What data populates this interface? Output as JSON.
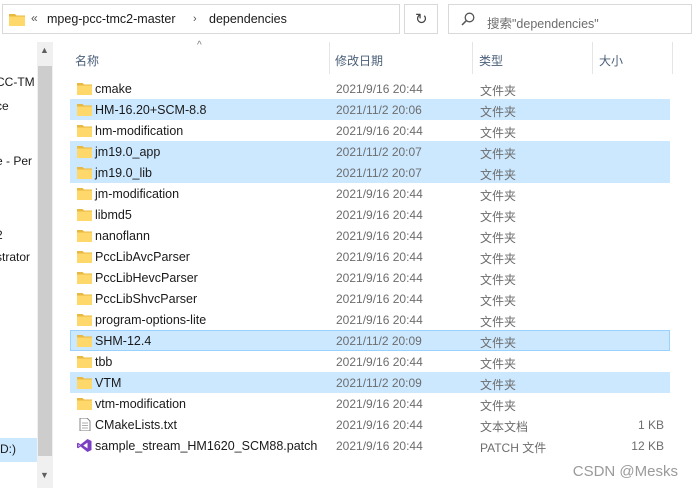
{
  "address": {
    "crumbs": [
      "mpeg-pcc-tmc2-master",
      "dependencies"
    ],
    "overflow": "«"
  },
  "search": {
    "placeholder": "搜索\"dependencies\""
  },
  "nav": {
    "items": [
      "CC-TM",
      "ce",
      "e - Per",
      "2",
      "strator",
      "D:)"
    ]
  },
  "columns": {
    "name": "名称",
    "date": "修改日期",
    "type": "类型",
    "size": "大小"
  },
  "rows": [
    {
      "name": "cmake",
      "date": "2021/9/16 20:44",
      "type": "文件夹",
      "size": "",
      "icon": "folder-icon",
      "state": ""
    },
    {
      "name": "HM-16.20+SCM-8.8",
      "date": "2021/11/2 20:06",
      "type": "文件夹",
      "size": "",
      "icon": "folder-icon",
      "state": "sel"
    },
    {
      "name": "hm-modification",
      "date": "2021/9/16 20:44",
      "type": "文件夹",
      "size": "",
      "icon": "folder-icon",
      "state": ""
    },
    {
      "name": "jm19.0_app",
      "date": "2021/11/2 20:07",
      "type": "文件夹",
      "size": "",
      "icon": "folder-icon",
      "state": "sel"
    },
    {
      "name": "jm19.0_lib",
      "date": "2021/11/2 20:07",
      "type": "文件夹",
      "size": "",
      "icon": "folder-icon",
      "state": "sel"
    },
    {
      "name": "jm-modification",
      "date": "2021/9/16 20:44",
      "type": "文件夹",
      "size": "",
      "icon": "folder-icon",
      "state": ""
    },
    {
      "name": "libmd5",
      "date": "2021/9/16 20:44",
      "type": "文件夹",
      "size": "",
      "icon": "folder-icon",
      "state": ""
    },
    {
      "name": "nanoflann",
      "date": "2021/9/16 20:44",
      "type": "文件夹",
      "size": "",
      "icon": "folder-icon",
      "state": ""
    },
    {
      "name": "PccLibAvcParser",
      "date": "2021/9/16 20:44",
      "type": "文件夹",
      "size": "",
      "icon": "folder-icon",
      "state": ""
    },
    {
      "name": "PccLibHevcParser",
      "date": "2021/9/16 20:44",
      "type": "文件夹",
      "size": "",
      "icon": "folder-icon",
      "state": ""
    },
    {
      "name": "PccLibShvcParser",
      "date": "2021/9/16 20:44",
      "type": "文件夹",
      "size": "",
      "icon": "folder-icon",
      "state": ""
    },
    {
      "name": "program-options-lite",
      "date": "2021/9/16 20:44",
      "type": "文件夹",
      "size": "",
      "icon": "folder-icon",
      "state": ""
    },
    {
      "name": "SHM-12.4",
      "date": "2021/11/2 20:09",
      "type": "文件夹",
      "size": "",
      "icon": "folder-icon",
      "state": "focus"
    },
    {
      "name": "tbb",
      "date": "2021/9/16 20:44",
      "type": "文件夹",
      "size": "",
      "icon": "folder-icon",
      "state": ""
    },
    {
      "name": "VTM",
      "date": "2021/11/2 20:09",
      "type": "文件夹",
      "size": "",
      "icon": "folder-icon",
      "state": "sel"
    },
    {
      "name": "vtm-modification",
      "date": "2021/9/16 20:44",
      "type": "文件夹",
      "size": "",
      "icon": "folder-icon",
      "state": ""
    },
    {
      "name": "CMakeLists.txt",
      "date": "2021/9/16 20:44",
      "type": "文本文档",
      "size": "1 KB",
      "icon": "text-file-icon",
      "state": ""
    },
    {
      "name": "sample_stream_HM1620_SCM88.patch",
      "date": "2021/9/16 20:44",
      "type": "PATCH 文件",
      "size": "12 KB",
      "icon": "visual-studio-icon",
      "state": ""
    }
  ],
  "watermark": "CSDN @Mesks",
  "colors": {
    "selection": "#cce8ff",
    "focus_border": "#99d1ff",
    "folder": "#ffd86b",
    "header_text": "#4c607a"
  }
}
